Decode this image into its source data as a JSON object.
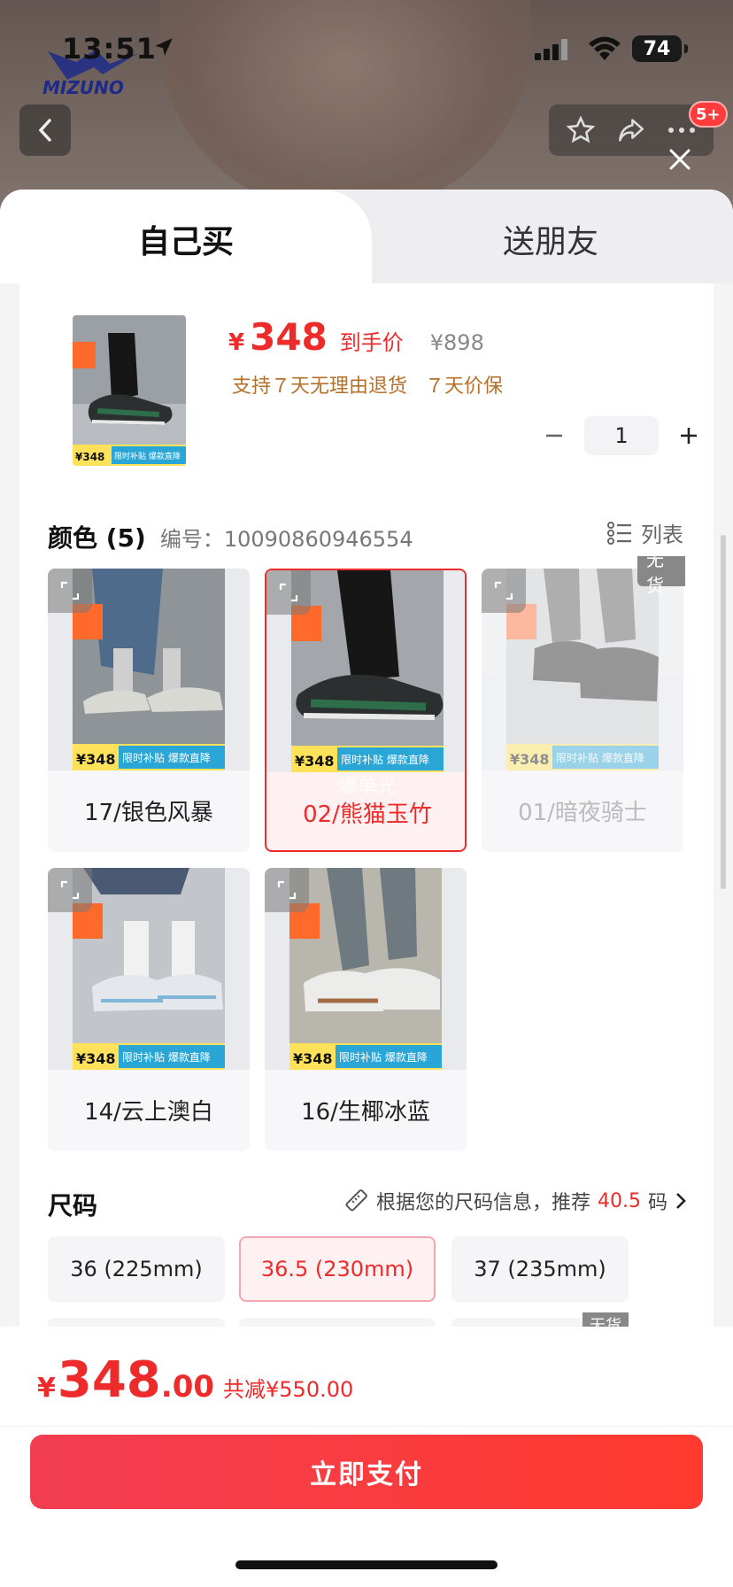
{
  "status_bar": {
    "time": "13:51",
    "battery": "74"
  },
  "background": {
    "brand_logo": "MIZUNO",
    "cart_badge": "5+"
  },
  "tabs": [
    {
      "label": "自己买",
      "active": true
    },
    {
      "label": "送朋友",
      "active": false
    }
  ],
  "product": {
    "price_symbol": "¥",
    "price": "348",
    "price_tag": "到手价",
    "original_price": "¥898",
    "support_return": "支持７天无理由退货",
    "support_price_protect": "７天价保",
    "thumb_promo": "限时补贴 爆款直降",
    "thumb_price": "¥348",
    "quantity": "1"
  },
  "color_section": {
    "title": "颜色 (5)",
    "code": "编号：10090860946554",
    "list_view_label": "列表",
    "out_of_stock_label": "无货",
    "options": [
      {
        "label": "17/银色风暴",
        "selected": false,
        "out_of_stock": false,
        "promo": "限时补贴 爆款直降",
        "price": "¥348"
      },
      {
        "label": "02/熊猫玉竹",
        "selected": true,
        "out_of_stock": false,
        "promo": "限时补贴 爆款直降",
        "price": "¥348",
        "tag": "爆单光"
      },
      {
        "label": "01/暗夜骑士",
        "selected": false,
        "out_of_stock": true,
        "promo": "限时补贴 爆款直降",
        "price": "¥348"
      },
      {
        "label": "14/云上澳白",
        "selected": false,
        "out_of_stock": false,
        "promo": "限时补贴 爆款直降",
        "price": "¥348"
      },
      {
        "label": "16/生椰冰蓝",
        "selected": false,
        "out_of_stock": false,
        "promo": "限时补贴 爆款直降",
        "price": "¥348"
      }
    ]
  },
  "size_section": {
    "title": "尺码",
    "recommend_prefix": "根据您的尺码信息，推荐",
    "recommend_value": "40.5",
    "recommend_suffix": "码",
    "options": [
      {
        "label": "36 (225mm)",
        "selected": false
      },
      {
        "label": "36.5 (230mm)",
        "selected": true
      },
      {
        "label": "37 (235mm)",
        "selected": false
      }
    ],
    "out_of_stock_label": "无货"
  },
  "bottom": {
    "total_symbol": "¥",
    "total_int": "348",
    "total_dec": ".00",
    "discount": "共减¥550.00",
    "pay_button": "立即支付"
  },
  "colors": {
    "accent": "#ee2b2b",
    "pay_gradient_start": "#f23d52",
    "pay_gradient_end": "#ff3a2e",
    "support_text": "#b5702b"
  }
}
